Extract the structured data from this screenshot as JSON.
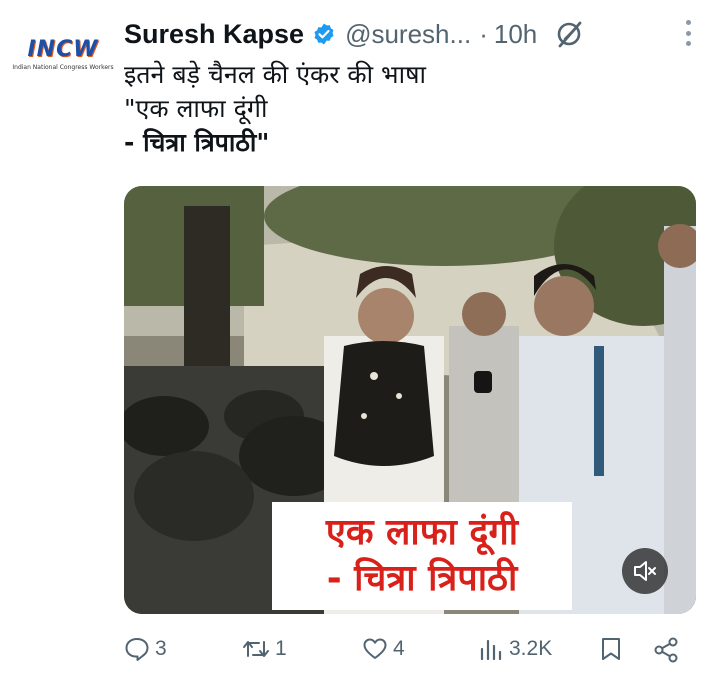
{
  "author": {
    "avatar_logo_text": "INCW",
    "avatar_logo_subtext": "Indian National Congress Workers",
    "name": "Suresh Kapse",
    "handle": "@suresh...",
    "separator": "·",
    "time": "10h",
    "verified": true
  },
  "tweet": {
    "lines": [
      "इतने बड़े चैनल की एंकर की  भाषा",
      "\"एक लाफा दूंगी",
      "- चित्रा  त्रिपाठी\""
    ]
  },
  "media": {
    "type": "video",
    "caption_lines": [
      "एक लाफा दूंगी",
      "- चित्रा  त्रिपाठी"
    ],
    "muted": true
  },
  "actions": {
    "replies": "3",
    "reposts": "1",
    "likes": "4",
    "views": "3.2K"
  },
  "colors": {
    "text_primary": "#0f1419",
    "text_secondary": "#536471",
    "verified_blue": "#1d9bf0",
    "caption_red": "#d9211b"
  },
  "icons": {
    "verified": "verified-badge-icon",
    "grok": "grok-icon",
    "more": "more-options-icon",
    "reply": "reply-icon",
    "repost": "repost-icon",
    "like": "like-icon",
    "views": "views-icon",
    "bookmark": "bookmark-icon",
    "share": "share-icon",
    "mute": "volume-muted-icon"
  }
}
